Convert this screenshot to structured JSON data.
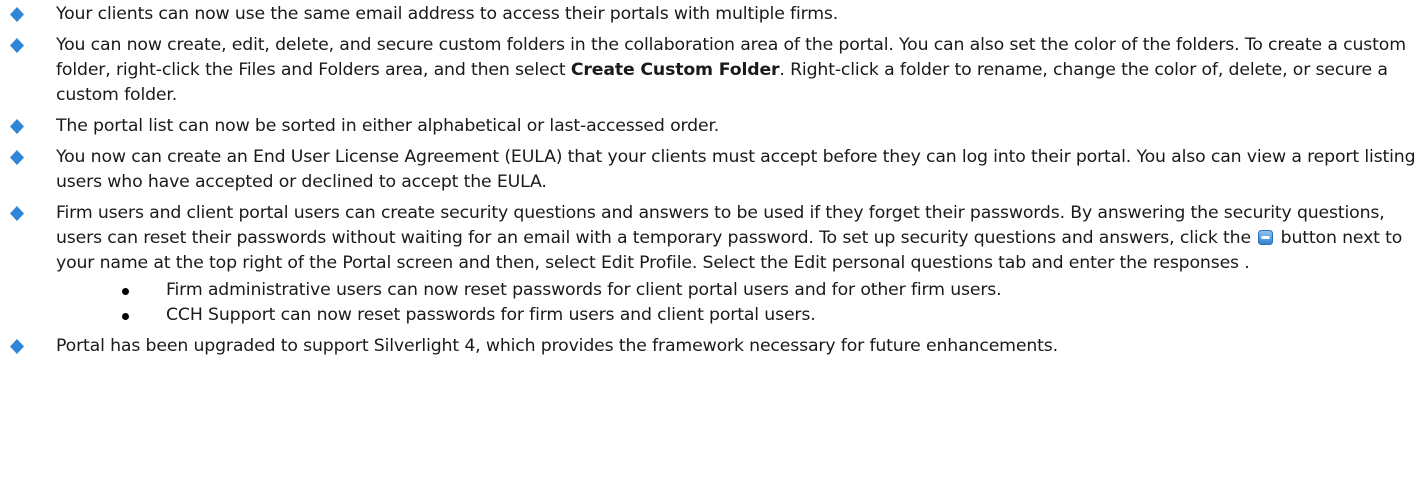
{
  "colors": {
    "bullet": "#2e86d6",
    "text": "#1a1a1a",
    "button_icon": "#3a8fdc"
  },
  "items": [
    {
      "text": "Your clients can now use the same email address to access their portals with multiple firms."
    },
    {
      "text_before": "You can now create, edit, delete, and secure custom folders in the collaboration area of the portal. You can also set the color of the folders.  To create a custom folder, right-click the Files and Folders area, and then select ",
      "bold": "Create Custom Folder",
      "text_after": ".  Right-click a folder to rename, change the color of, delete, or secure a custom folder."
    },
    {
      "text": "The portal list can now be sorted in either alphabetical or last-accessed order."
    },
    {
      "text": "You now can create an End User License Agreement (EULA) that your clients must accept before they can log into their portal. You also can view a report listing users who have accepted or declined to accept the EULA."
    },
    {
      "text_before": "Firm users and client portal users can create security questions and answers to be used if they forget their passwords.  By answering the security questions, users can reset their passwords without waiting for an email with a temporary password.  To set up security questions and answers, click the ",
      "icon": "dropdown-button-icon",
      "text_after": " button next to your name at the top right of the Portal screen and then, select Edit Profile. Select the Edit personal questions tab and enter the responses .",
      "sub_items": [
        "Firm administrative users can now reset passwords for client portal users and for other firm users.",
        "CCH Support can now reset passwords for firm users and client portal users."
      ]
    },
    {
      "text": "Portal has been upgraded to support Silverlight 4, which provides the framework necessary for future enhancements."
    }
  ]
}
